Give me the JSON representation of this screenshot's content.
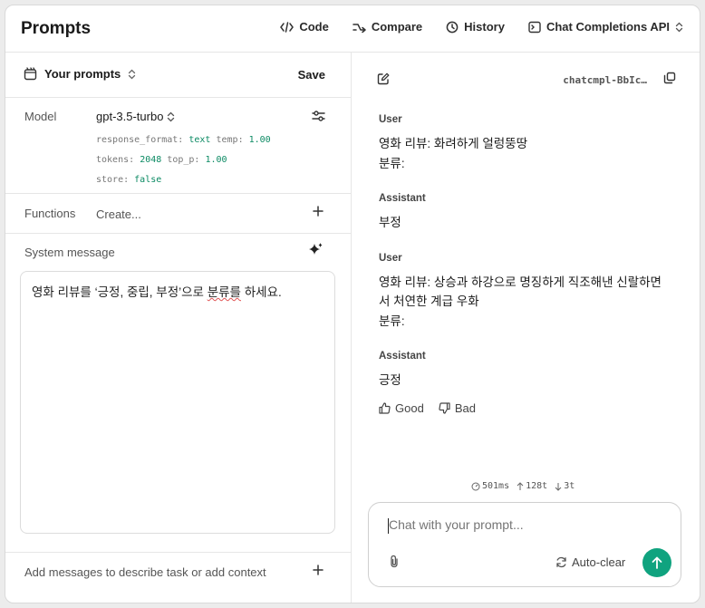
{
  "header": {
    "title": "Prompts",
    "nav": [
      {
        "label": "Code"
      },
      {
        "label": "Compare"
      },
      {
        "label": "History"
      },
      {
        "label": "Chat Completions API"
      }
    ]
  },
  "left": {
    "your_prompts": "Your prompts",
    "save": "Save",
    "model_label": "Model",
    "model_value": "gpt-3.5-turbo",
    "params": {
      "response_format_key": "response_format:",
      "response_format_val": "text",
      "temp_key": "temp:",
      "temp_val": "1.00",
      "tokens_key": "tokens:",
      "tokens_val": "2048",
      "top_p_key": "top_p:",
      "top_p_val": "1.00",
      "store_key": "store:",
      "store_val": "false"
    },
    "functions_label": "Functions",
    "functions_create": "Create...",
    "system_label": "System message",
    "system_text_a": "영화 리뷰를 ‘긍정, 중립, 부정’으로 ",
    "system_text_b": "분류를",
    "system_text_c": " 하세요.",
    "add_messages": "Add messages to describe task or add context"
  },
  "right": {
    "completion_id": "chatcmpl-BbIc…",
    "messages": [
      {
        "role": "User",
        "content": "영화 리뷰: 화려하게 얼렁뚱땅\n분류:"
      },
      {
        "role": "Assistant",
        "content": "부정"
      },
      {
        "role": "User",
        "content": "영화 리뷰: 상승과 하강으로 명징하게 직조해낸 신랄하면서 처연한 계급 우화\n분류:"
      },
      {
        "role": "Assistant",
        "content": "긍정"
      }
    ],
    "feedback": {
      "good": "Good",
      "bad": "Bad"
    },
    "stats": {
      "latency": "501ms",
      "tokens_up": "128t",
      "tokens_down": "3t"
    },
    "chat": {
      "placeholder": "Chat with your prompt...",
      "auto_clear": "Auto-clear"
    }
  },
  "colors": {
    "accent": "#10a37f",
    "param_value": "#0b8a63"
  }
}
